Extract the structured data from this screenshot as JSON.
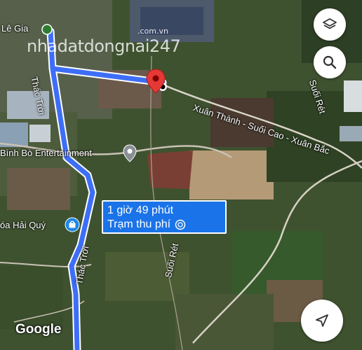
{
  "map": {
    "places": {
      "le_gia": "Lê Gia",
      "binh_bo": "Bình Bò Entertainment",
      "hoa_hai_quy": "óa Hải Quý"
    },
    "roads": {
      "thac_troi_top": "Thác Trời",
      "thac_troi_bottom": "Thác Trời",
      "xuan_thanh": "Xuân Thành - Suối Cao - Xuân Bắc",
      "suoi_ret_top": "Suối Rét",
      "suoi_ret_mid": "Suối Rét"
    },
    "eta": {
      "duration": "1 giờ 49 phút",
      "note": "Trạm thu phí"
    },
    "watermark": {
      "main": "nhadatdongnai247",
      "sub": ".com.vn"
    },
    "attribution": "Google",
    "route_color": "#3d6ef7",
    "pin_color": "#e53935"
  },
  "controls": {
    "layers": "layers-icon",
    "search": "search-icon",
    "navigate": "navigation-arrow-icon"
  }
}
